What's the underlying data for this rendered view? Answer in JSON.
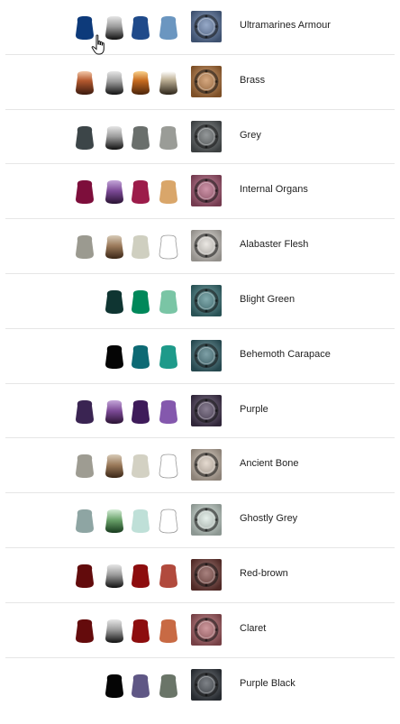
{
  "recipes": [
    {
      "name": "Ultramarines Armour",
      "base": "#0d3a7a",
      "shade": "shade-grey",
      "layer": "#1f4a8a",
      "edge": "#6b96c0",
      "thumb": "#5f7cab"
    },
    {
      "name": "Brass",
      "base": "shade-copper",
      "shade": "shade-grey",
      "layer": "shade-bronze",
      "edge": "shade-gold",
      "thumb": "#c07a3c"
    },
    {
      "name": "Grey",
      "base": "#3c4548",
      "shade": "shade-grey",
      "layer": "#6a6f6c",
      "edge": "#9a9c97",
      "thumb": "#5c6264"
    },
    {
      "name": "Internal Organs",
      "base": "#7d0e3b",
      "shade": "shade-purple",
      "layer": "#9c1c4a",
      "edge": "#d9a66a",
      "thumb": "#b35b7a"
    },
    {
      "name": "Alabaster Flesh",
      "base": "#9b9a90",
      "shade": "shade-tan",
      "layer": "#cfcfc0",
      "edge": "#ffffff",
      "thumb": "#e1dcd5"
    },
    {
      "name": "Blight Green",
      "base": null,
      "shade": "#0f3532",
      "layer": "#00885a",
      "edge": "#7ac5a5",
      "thumb": "#3f7e83"
    },
    {
      "name": "Behemoth Carapace",
      "base": null,
      "shade": "#050505",
      "layer": "#0d6a74",
      "edge": "#1e9a8a",
      "thumb": "#3a6e78"
    },
    {
      "name": "Purple",
      "base": "#3a2452",
      "shade": "shade-purple",
      "layer": "#3e1b5a",
      "edge": "#8458ad",
      "thumb": "#4a3a58"
    },
    {
      "name": "Ancient Bone",
      "base": "#9e9c92",
      "shade": "shade-tan",
      "layer": "#d3d1c3",
      "edge": "#ffffff",
      "thumb": "#d8c8b8"
    },
    {
      "name": "Ghostly Grey",
      "base": "#8ea5a3",
      "shade": "shade-green",
      "layer": "#bfe0d8",
      "edge": "#ffffff",
      "thumb": "#d8e8e0"
    },
    {
      "name": "Red-brown",
      "base": "#620b0c",
      "shade": "shade-grey",
      "layer": "#8d0d0e",
      "edge": "#b14a3d",
      "thumb": "#7a3f3a"
    },
    {
      "name": "Claret",
      "base": "#640b0c",
      "shade": "shade-grey",
      "layer": "#8d0d0e",
      "edge": "#c86a44",
      "thumb": "#b5636a"
    },
    {
      "name": "Purple Black",
      "base": null,
      "shade": "#050505",
      "layer": "#5f5785",
      "edge": "#6a7568",
      "thumb": "#3a4048"
    }
  ]
}
